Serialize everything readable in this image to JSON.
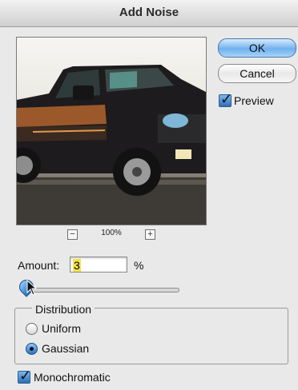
{
  "window": {
    "title": "Add Noise"
  },
  "buttons": {
    "ok": "OK",
    "cancel": "Cancel"
  },
  "preview": {
    "label": "Preview",
    "checked": true,
    "zoom": "100%",
    "zoom_out": "−",
    "zoom_in": "+"
  },
  "amount": {
    "label": "Amount:",
    "value": "3",
    "unit": "%",
    "slider_fraction": 0.03
  },
  "distribution": {
    "title": "Distribution",
    "options": [
      {
        "label": "Uniform",
        "selected": false
      },
      {
        "label": "Gaussian",
        "selected": true
      }
    ]
  },
  "monochromatic": {
    "label": "Monochromatic",
    "checked": true
  },
  "colors": {
    "ok_button": "#6fb1ef",
    "checkbox": "#2c6fb8",
    "highlight": "#f2e34b"
  }
}
